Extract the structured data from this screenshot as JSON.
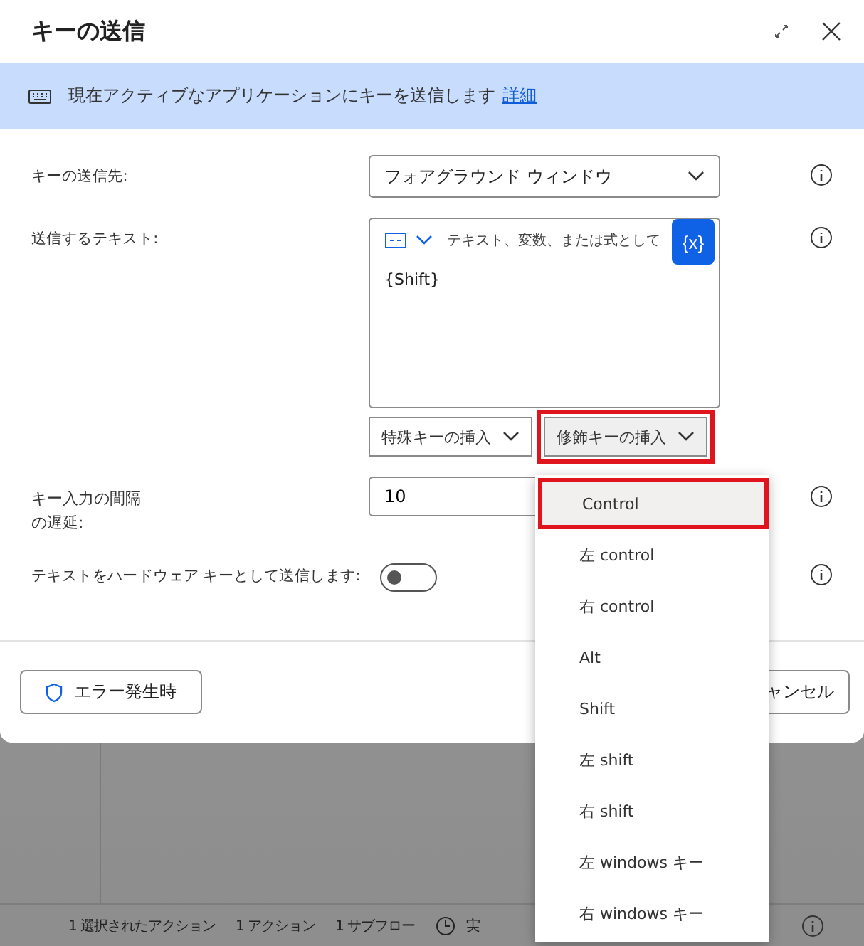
{
  "dialog": {
    "title": "キーの送信",
    "banner": {
      "text": "現在アクティブなアプリケーションにキーを送信します",
      "link": "詳細"
    },
    "fields": [
      {
        "kind": "select",
        "label": "キーの送信先:",
        "value": "フォアグラウンド ウィンドウ"
      },
      {
        "kind": "text",
        "label": "送信するテキスト:",
        "placeholder": "テキスト、変数、または式として",
        "value": "{Shift}",
        "variable_button": "{x}",
        "insert_buttons": [
          {
            "label": "特殊キーの挿入",
            "highlighted": false
          },
          {
            "label": "修飾キーの挿入",
            "highlighted": true
          }
        ]
      },
      {
        "kind": "number",
        "label_lines": [
          "キー入力の間隔",
          "の遅延:"
        ],
        "value": "10"
      },
      {
        "kind": "toggle",
        "label": "テキストをハードウェア キーとして送信します:",
        "on": false
      }
    ],
    "footer": {
      "error_button": "エラー発生時",
      "cancel_button": "ャンセル"
    }
  },
  "menu": [
    {
      "label": "Control",
      "selected": true
    },
    {
      "label": "左 control",
      "selected": false
    },
    {
      "label": "右 control",
      "selected": false
    },
    {
      "label": "Alt",
      "selected": false
    },
    {
      "label": "Shift",
      "selected": false
    },
    {
      "label": "左 shift",
      "selected": false
    },
    {
      "label": "右 shift",
      "selected": false
    },
    {
      "label": "左 windows キー",
      "selected": false
    },
    {
      "label": "右 windows キー",
      "selected": false
    }
  ],
  "status_bar": [
    "1 選択されたアクション",
    "1 アクション",
    "1 サブフロー",
    "実"
  ]
}
